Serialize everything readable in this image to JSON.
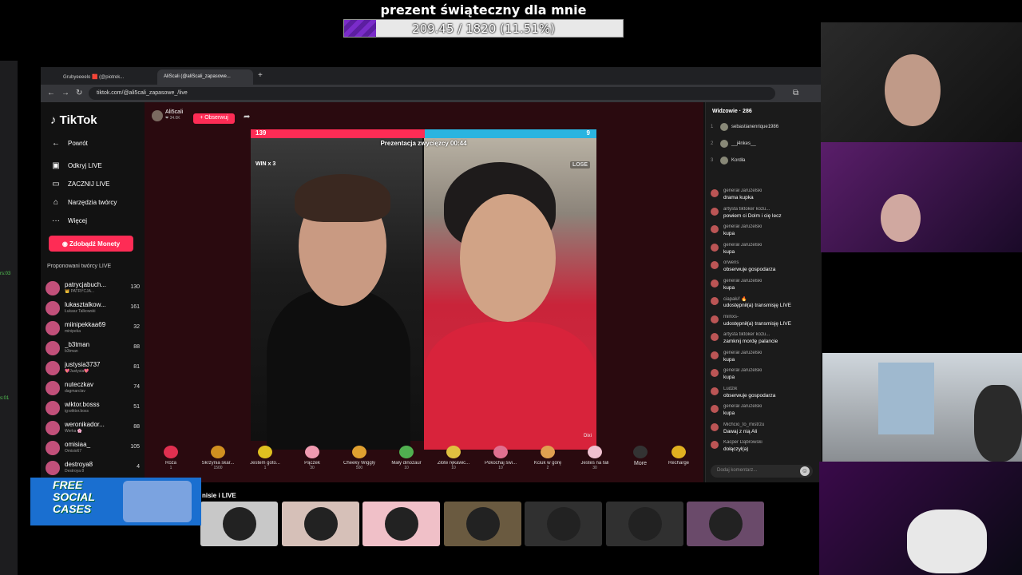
{
  "goal": {
    "title": "prezent świąteczny dla mnie",
    "text": "209.45 / 1820 (11.51%)",
    "progress": 0.1151
  },
  "browser": {
    "tabs": [
      "Grubyeeeelo 🟥 (@piotrek...",
      "AliScali (@aliScali_zapasowe..."
    ],
    "url": "tiktok.com/@ali5cali_zapasowe_/live"
  },
  "sidebar": {
    "logo": "TikTok",
    "back": "Powrót",
    "items": [
      "Odkryj LIVE",
      "ZACZNIJ LIVE",
      "Narzędzia twórcy",
      "Więcej"
    ],
    "coins_button": "Zdobądź Monety",
    "suggest_title": "Proponowani twórcy LIVE",
    "creators": [
      {
        "name": "patrycjabuch...",
        "sub": "👑 PATRYCJA...",
        "count": "130"
      },
      {
        "name": "lukasztalkow...",
        "sub": "Łukasz Talkowski",
        "count": "161"
      },
      {
        "name": "miinipekkaa69",
        "sub": "minipeka",
        "count": "32"
      },
      {
        "name": "_b3tman",
        "sub": "b3tman",
        "count": "88"
      },
      {
        "name": "justysia3737",
        "sub": "💖Justysia💖",
        "count": "81"
      },
      {
        "name": "nuteczkav",
        "sub": "dagmarclav",
        "count": "74"
      },
      {
        "name": "wiktor.bosss",
        "sub": "ig:wiktor.boss",
        "count": "51"
      },
      {
        "name": "weronikador...",
        "sub": "Werka 🌸",
        "count": "88"
      },
      {
        "name": "omisiaa_",
        "sub": "Omisio67",
        "count": "105"
      },
      {
        "name": "destroya8",
        "sub": "Destroya 8",
        "count": "4"
      }
    ]
  },
  "stream": {
    "host_name": "Ali5cali",
    "host_sub": "❤ 34.0K",
    "follow": "+ Obserwuj",
    "battle_title": "Prezentacja zwycięzcy 00:44",
    "score_left": "139",
    "score_right": "9",
    "win_label": "WIN x 3",
    "lose_label": "LOSE",
    "watermark": "Dixi"
  },
  "gifts": [
    {
      "name": "Róża",
      "price": "1",
      "color": "#e03050"
    },
    {
      "name": "Skrzynia skar...",
      "price": "1500",
      "color": "#d09020"
    },
    {
      "name": "Jestem goto...",
      "price": "1",
      "color": "#e0c020"
    },
    {
      "name": "Pączek",
      "price": "30",
      "color": "#f09ab0"
    },
    {
      "name": "Cheeky Wiggly",
      "price": "500",
      "color": "#e0a030"
    },
    {
      "name": "Mały dinozaur",
      "price": "10",
      "color": "#50b050"
    },
    {
      "name": "Złote rękawic...",
      "price": "10",
      "color": "#e0c040"
    },
    {
      "name": "Pokochaj świ...",
      "price": "10",
      "color": "#e07090"
    },
    {
      "name": "Kciuk w górę",
      "price": "2",
      "color": "#e0a050"
    },
    {
      "name": "Jesteś na fali",
      "price": "30",
      "color": "#f0c0d0"
    }
  ],
  "gifts_more": "More",
  "recharge": "Recharge",
  "chat": {
    "viewers_title": "Widzowie · 286",
    "viewers": [
      {
        "rank": "1",
        "name": "sebastianenrique1986"
      },
      {
        "rank": "2",
        "name": "__j4nkes__"
      },
      {
        "rank": "3",
        "name": "Kordła"
      }
    ],
    "messages": [
      {
        "name": "generał Jaruzelski",
        "text": "drama kupka"
      },
      {
        "name": "artysta tiktoker kozu...",
        "text": "powiem ci Dolm i cię lecz"
      },
      {
        "name": "generał Jaruzelski",
        "text": "kupa"
      },
      {
        "name": "generał Jaruzelski",
        "text": "kupa"
      },
      {
        "name": "orwens",
        "text": "obserwuje gospodarza"
      },
      {
        "name": "generał Jaruzelski",
        "text": "kupa"
      },
      {
        "name": "ciapak// 🔥",
        "text": "udostępnił(a) transmisję LIVE"
      },
      {
        "name": "milnxs-",
        "text": "udostępnił(a) transmisję LIVE"
      },
      {
        "name": "artysta tiktoker kozu...",
        "text": "zamknij mordę palancie"
      },
      {
        "name": "generał Jaruzelski",
        "text": "kupa"
      },
      {
        "name": "generał Jaruzelski",
        "text": "kupa"
      },
      {
        "name": "Ludzik",
        "text": "obserwuje gospodarza"
      },
      {
        "name": "generał Jaruzelski",
        "text": "kupa"
      },
      {
        "name": "Michcio_to_mistrzu",
        "text": "Dawaj z nią Ali"
      },
      {
        "name": "Kacper Dąbrowski",
        "text": "dołączył(a)"
      }
    ],
    "comment_placeholder": "Dodaj komentarz..."
  },
  "more_label": "nisie i LIVE",
  "ad": {
    "line1": "FREE",
    "line2": "SOCIAL",
    "line3": "CASES"
  },
  "thumbs": [
    "#c8c8c8",
    "#d6c0b8",
    "#f0c0c8",
    "#6a5a40",
    "#303030",
    "#303030",
    "#6a4a6a"
  ]
}
